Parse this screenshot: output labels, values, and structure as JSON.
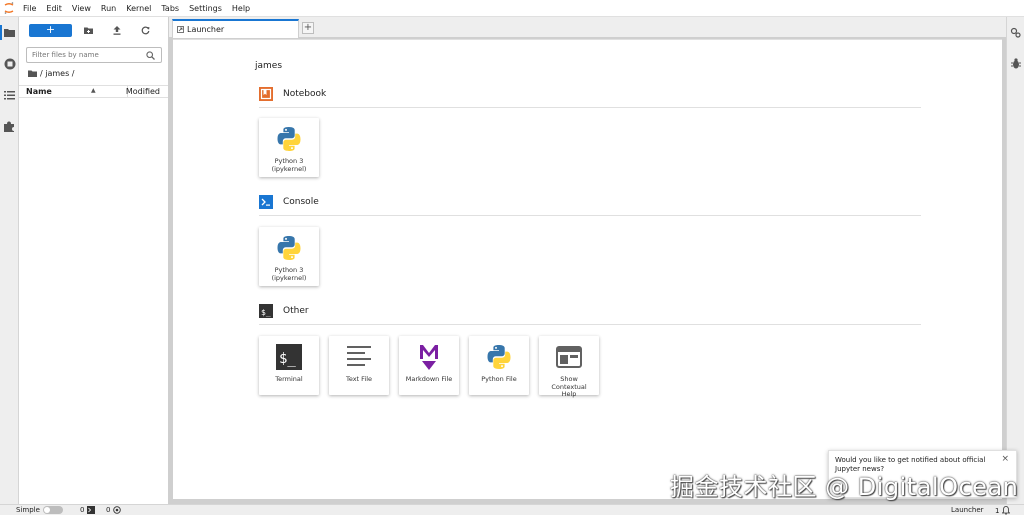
{
  "menu": [
    "File",
    "Edit",
    "View",
    "Run",
    "Kernel",
    "Tabs",
    "Settings",
    "Help"
  ],
  "filebrowser": {
    "new_label": "+",
    "filter_placeholder": "Filter files by name",
    "breadcrumb": "/ james /",
    "col_name": "Name",
    "col_modified": "Modified"
  },
  "tabs": {
    "active_label": "Launcher",
    "add_label": "+"
  },
  "launcher": {
    "cwd": "james",
    "sections": [
      {
        "title": "Notebook",
        "items": [
          {
            "label": "Python 3 (ipykernel)"
          }
        ]
      },
      {
        "title": "Console",
        "items": [
          {
            "label": "Python 3 (ipykernel)"
          }
        ]
      },
      {
        "title": "Other",
        "items": [
          {
            "label": "Terminal"
          },
          {
            "label": "Text File"
          },
          {
            "label": "Markdown File"
          },
          {
            "label": "Python File"
          },
          {
            "label": "Show Contextual Help"
          }
        ]
      }
    ]
  },
  "statusbar": {
    "mode": "Simple",
    "terminals": "0",
    "kernels": "0",
    "right_label": "Launcher",
    "right_count": "1"
  },
  "toast": {
    "message": "Would you like to get notified about official Jupyter news?",
    "close": "×"
  },
  "watermark": "掘金技术社区 @ DigitalOcean",
  "colors": {
    "accent": "#1976d2",
    "notebook_icon": "#e46e2e",
    "console_icon": "#1976d2",
    "markdown_icon": "#7b1fa2"
  }
}
